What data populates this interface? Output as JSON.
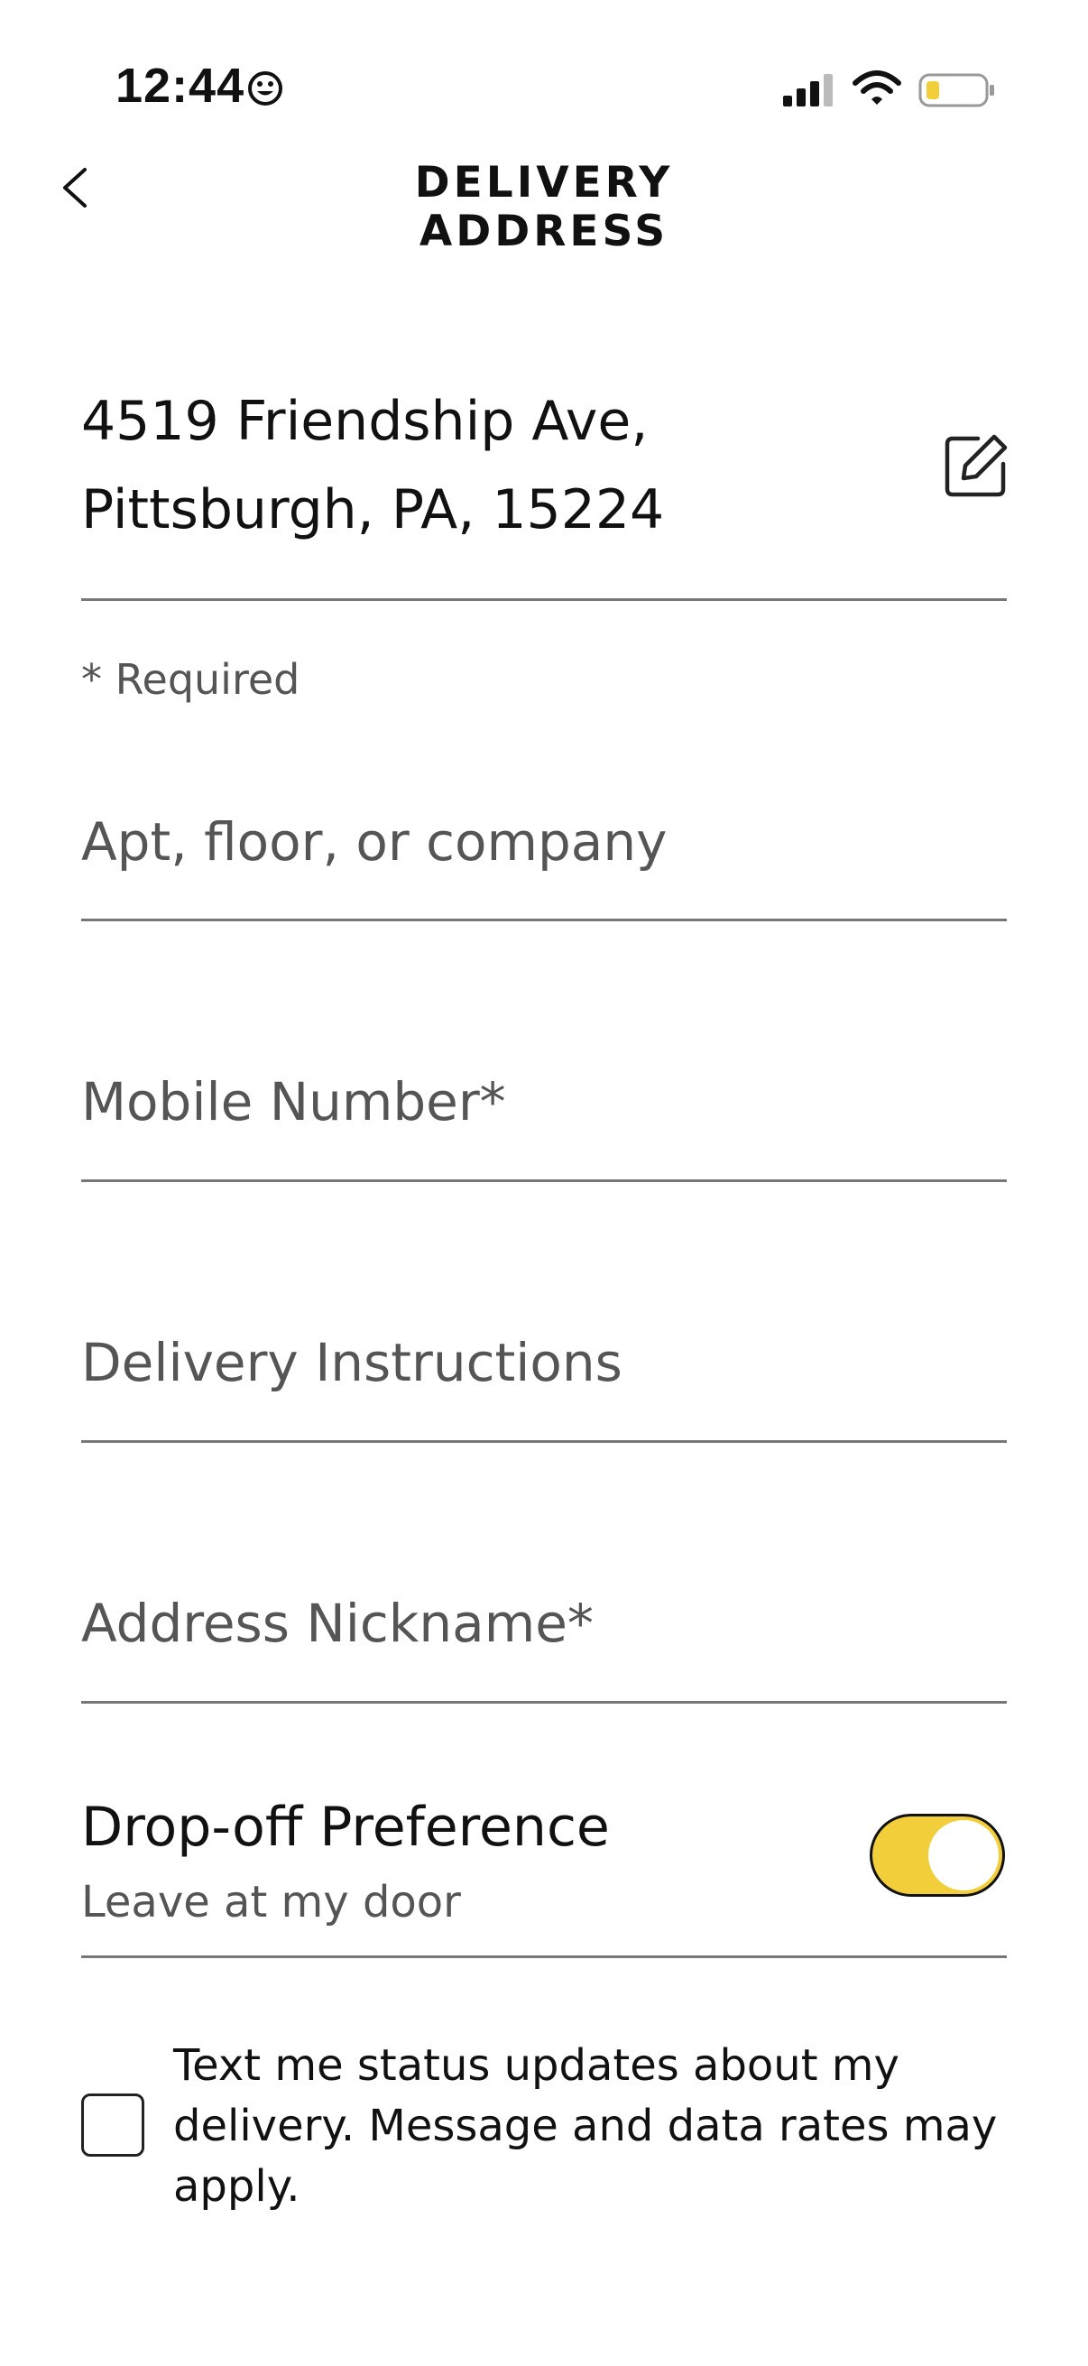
{
  "status_bar": {
    "time": "12:44"
  },
  "header": {
    "title_line1": "DELIVERY",
    "title_line2": "ADDRESS"
  },
  "address": {
    "line1": "4519 Friendship Ave,",
    "line2": "Pittsburgh, PA, 15224"
  },
  "required_note": "* Required",
  "fields": {
    "apt": {
      "placeholder": "Apt, floor, or company",
      "value": ""
    },
    "mobile": {
      "placeholder": "Mobile Number*",
      "value": ""
    },
    "instructions": {
      "placeholder": "Delivery Instructions",
      "value": ""
    },
    "nickname": {
      "placeholder": "Address Nickname*",
      "value": ""
    }
  },
  "dropoff": {
    "label": "Drop-off Preference",
    "value": "Leave at my door",
    "toggle_on": true
  },
  "sms_consent": {
    "text": "Text me status updates about my delivery. Message and data rates may apply.",
    "checked": false
  },
  "colors": {
    "accent": "#F2CF3A",
    "battery_fill": "#F2CF3A",
    "text": "#111111",
    "muted": "#555555"
  },
  "icons": [
    "smiley-icon",
    "signal-icon",
    "wifi-icon",
    "battery-icon",
    "back-chevron-icon",
    "edit-icon"
  ]
}
